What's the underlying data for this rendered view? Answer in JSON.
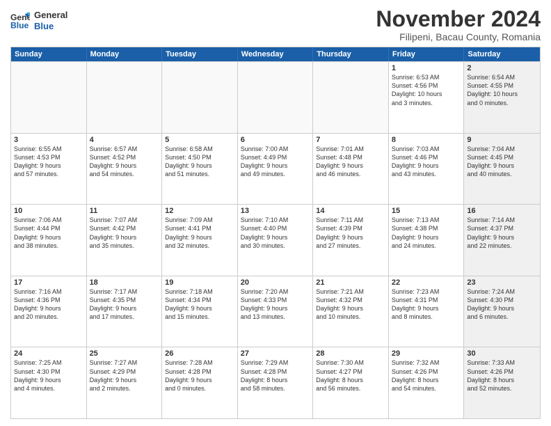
{
  "logo": {
    "line1": "General",
    "line2": "Blue"
  },
  "title": "November 2024",
  "subtitle": "Filipeni, Bacau County, Romania",
  "header_days": [
    "Sunday",
    "Monday",
    "Tuesday",
    "Wednesday",
    "Thursday",
    "Friday",
    "Saturday"
  ],
  "rows": [
    [
      {
        "day": "",
        "info": "",
        "shaded": false,
        "empty": true
      },
      {
        "day": "",
        "info": "",
        "shaded": false,
        "empty": true
      },
      {
        "day": "",
        "info": "",
        "shaded": false,
        "empty": true
      },
      {
        "day": "",
        "info": "",
        "shaded": false,
        "empty": true
      },
      {
        "day": "",
        "info": "",
        "shaded": false,
        "empty": true
      },
      {
        "day": "1",
        "info": "Sunrise: 6:53 AM\nSunset: 4:56 PM\nDaylight: 10 hours\nand 3 minutes.",
        "shaded": false,
        "empty": false
      },
      {
        "day": "2",
        "info": "Sunrise: 6:54 AM\nSunset: 4:55 PM\nDaylight: 10 hours\nand 0 minutes.",
        "shaded": true,
        "empty": false
      }
    ],
    [
      {
        "day": "3",
        "info": "Sunrise: 6:55 AM\nSunset: 4:53 PM\nDaylight: 9 hours\nand 57 minutes.",
        "shaded": false,
        "empty": false
      },
      {
        "day": "4",
        "info": "Sunrise: 6:57 AM\nSunset: 4:52 PM\nDaylight: 9 hours\nand 54 minutes.",
        "shaded": false,
        "empty": false
      },
      {
        "day": "5",
        "info": "Sunrise: 6:58 AM\nSunset: 4:50 PM\nDaylight: 9 hours\nand 51 minutes.",
        "shaded": false,
        "empty": false
      },
      {
        "day": "6",
        "info": "Sunrise: 7:00 AM\nSunset: 4:49 PM\nDaylight: 9 hours\nand 49 minutes.",
        "shaded": false,
        "empty": false
      },
      {
        "day": "7",
        "info": "Sunrise: 7:01 AM\nSunset: 4:48 PM\nDaylight: 9 hours\nand 46 minutes.",
        "shaded": false,
        "empty": false
      },
      {
        "day": "8",
        "info": "Sunrise: 7:03 AM\nSunset: 4:46 PM\nDaylight: 9 hours\nand 43 minutes.",
        "shaded": false,
        "empty": false
      },
      {
        "day": "9",
        "info": "Sunrise: 7:04 AM\nSunset: 4:45 PM\nDaylight: 9 hours\nand 40 minutes.",
        "shaded": true,
        "empty": false
      }
    ],
    [
      {
        "day": "10",
        "info": "Sunrise: 7:06 AM\nSunset: 4:44 PM\nDaylight: 9 hours\nand 38 minutes.",
        "shaded": false,
        "empty": false
      },
      {
        "day": "11",
        "info": "Sunrise: 7:07 AM\nSunset: 4:42 PM\nDaylight: 9 hours\nand 35 minutes.",
        "shaded": false,
        "empty": false
      },
      {
        "day": "12",
        "info": "Sunrise: 7:09 AM\nSunset: 4:41 PM\nDaylight: 9 hours\nand 32 minutes.",
        "shaded": false,
        "empty": false
      },
      {
        "day": "13",
        "info": "Sunrise: 7:10 AM\nSunset: 4:40 PM\nDaylight: 9 hours\nand 30 minutes.",
        "shaded": false,
        "empty": false
      },
      {
        "day": "14",
        "info": "Sunrise: 7:11 AM\nSunset: 4:39 PM\nDaylight: 9 hours\nand 27 minutes.",
        "shaded": false,
        "empty": false
      },
      {
        "day": "15",
        "info": "Sunrise: 7:13 AM\nSunset: 4:38 PM\nDaylight: 9 hours\nand 24 minutes.",
        "shaded": false,
        "empty": false
      },
      {
        "day": "16",
        "info": "Sunrise: 7:14 AM\nSunset: 4:37 PM\nDaylight: 9 hours\nand 22 minutes.",
        "shaded": true,
        "empty": false
      }
    ],
    [
      {
        "day": "17",
        "info": "Sunrise: 7:16 AM\nSunset: 4:36 PM\nDaylight: 9 hours\nand 20 minutes.",
        "shaded": false,
        "empty": false
      },
      {
        "day": "18",
        "info": "Sunrise: 7:17 AM\nSunset: 4:35 PM\nDaylight: 9 hours\nand 17 minutes.",
        "shaded": false,
        "empty": false
      },
      {
        "day": "19",
        "info": "Sunrise: 7:18 AM\nSunset: 4:34 PM\nDaylight: 9 hours\nand 15 minutes.",
        "shaded": false,
        "empty": false
      },
      {
        "day": "20",
        "info": "Sunrise: 7:20 AM\nSunset: 4:33 PM\nDaylight: 9 hours\nand 13 minutes.",
        "shaded": false,
        "empty": false
      },
      {
        "day": "21",
        "info": "Sunrise: 7:21 AM\nSunset: 4:32 PM\nDaylight: 9 hours\nand 10 minutes.",
        "shaded": false,
        "empty": false
      },
      {
        "day": "22",
        "info": "Sunrise: 7:23 AM\nSunset: 4:31 PM\nDaylight: 9 hours\nand 8 minutes.",
        "shaded": false,
        "empty": false
      },
      {
        "day": "23",
        "info": "Sunrise: 7:24 AM\nSunset: 4:30 PM\nDaylight: 9 hours\nand 6 minutes.",
        "shaded": true,
        "empty": false
      }
    ],
    [
      {
        "day": "24",
        "info": "Sunrise: 7:25 AM\nSunset: 4:30 PM\nDaylight: 9 hours\nand 4 minutes.",
        "shaded": false,
        "empty": false
      },
      {
        "day": "25",
        "info": "Sunrise: 7:27 AM\nSunset: 4:29 PM\nDaylight: 9 hours\nand 2 minutes.",
        "shaded": false,
        "empty": false
      },
      {
        "day": "26",
        "info": "Sunrise: 7:28 AM\nSunset: 4:28 PM\nDaylight: 9 hours\nand 0 minutes.",
        "shaded": false,
        "empty": false
      },
      {
        "day": "27",
        "info": "Sunrise: 7:29 AM\nSunset: 4:28 PM\nDaylight: 8 hours\nand 58 minutes.",
        "shaded": false,
        "empty": false
      },
      {
        "day": "28",
        "info": "Sunrise: 7:30 AM\nSunset: 4:27 PM\nDaylight: 8 hours\nand 56 minutes.",
        "shaded": false,
        "empty": false
      },
      {
        "day": "29",
        "info": "Sunrise: 7:32 AM\nSunset: 4:26 PM\nDaylight: 8 hours\nand 54 minutes.",
        "shaded": false,
        "empty": false
      },
      {
        "day": "30",
        "info": "Sunrise: 7:33 AM\nSunset: 4:26 PM\nDaylight: 8 hours\nand 52 minutes.",
        "shaded": true,
        "empty": false
      }
    ]
  ]
}
